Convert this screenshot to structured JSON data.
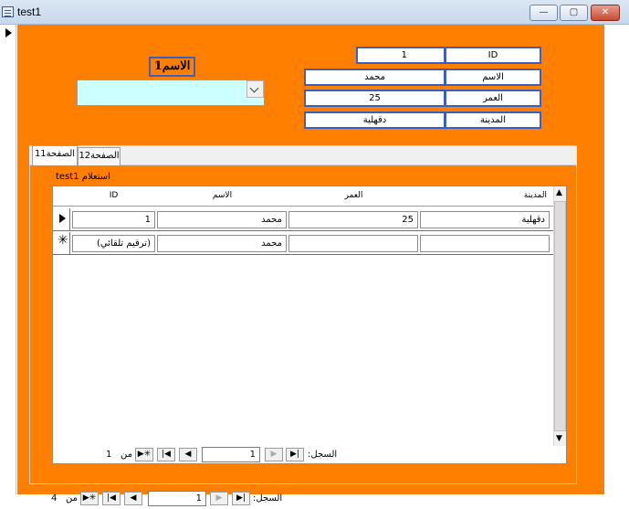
{
  "window": {
    "title": "test1",
    "minimize_glyph": "—",
    "maximize_glyph": "▢",
    "close_glyph": "✕"
  },
  "form": {
    "name_label": "الاسم1",
    "combo_value": "",
    "fields": [
      {
        "label": "ID",
        "value": "1"
      },
      {
        "label": "الاسم",
        "value": "محمد"
      },
      {
        "label": "العمر",
        "value": "25"
      },
      {
        "label": "المدينة",
        "value": "دقهلية"
      }
    ]
  },
  "tabs": [
    {
      "label": "الصفحة11"
    },
    {
      "label": "الصفحة12"
    }
  ],
  "subform": {
    "label": "استعلام test1",
    "columns": [
      "المدينة",
      "العمر",
      "الاسم",
      "ID"
    ],
    "rows": [
      {
        "selector": "current",
        "city": "دقهلية",
        "age": "25",
        "name": "محمد",
        "id": "1"
      },
      {
        "selector": "new",
        "city": "",
        "age": "",
        "name": "محمد",
        "id": "(ترقيم تلقائي)"
      }
    ],
    "nav": {
      "record_label": "السجل:",
      "current": "1",
      "of_label": "من",
      "total": "1"
    }
  },
  "main_nav": {
    "record_label": "السجل:",
    "current": "1",
    "of_label": "من",
    "total": "4"
  },
  "colors": {
    "form_bg": "#ff8000",
    "field_border": "#3d5fc0",
    "combo_bg": "#ccffff"
  }
}
